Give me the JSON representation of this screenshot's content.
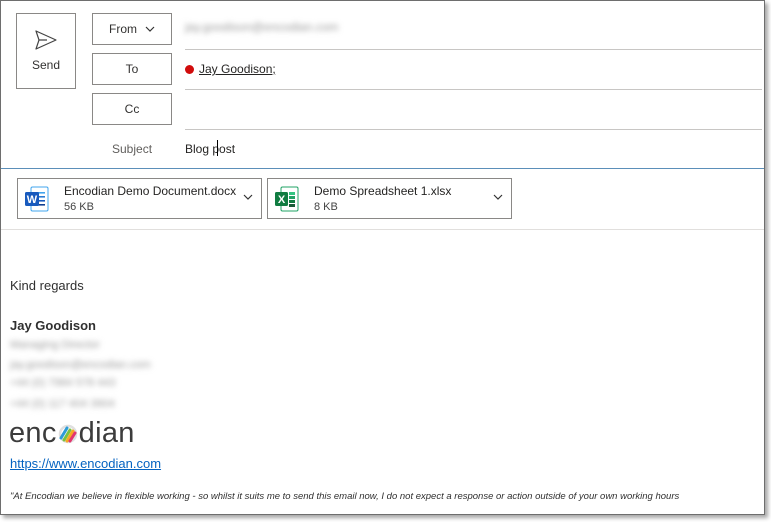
{
  "header": {
    "send_label": "Send",
    "from_label": "From",
    "from_address": "jay.goodison@encodian.com",
    "to_label": "To",
    "cc_label": "Cc",
    "subject_label": "Subject"
  },
  "recipients": [
    {
      "name": "Jay Goodison;",
      "status_color": "#d10c0c"
    }
  ],
  "subject": "Blog post",
  "attachments": [
    {
      "name": "Encodian Demo Document.docx",
      "size": "56 KB",
      "icon": "word-icon"
    },
    {
      "name": "Demo Spreadsheet 1.xlsx",
      "size": "8 KB",
      "icon": "excel-icon"
    }
  ],
  "body": {
    "greeting": "Kind regards",
    "signature": {
      "name": "Jay Goodison",
      "title_blurred": "Managing Director",
      "email_blurred": "jay.goodison@encodian.com",
      "phone1_blurred": "+44 (0) 7984 578 443",
      "phone2_blurred": "+44 (0) 117 404 3904",
      "logo_prefix": "enc",
      "logo_suffix": "dian",
      "website": "https://www.encodian.com",
      "disclaimer": "\"At Encodian we believe in flexible working - so whilst it suits me to send this email now, I do not expect a response or action outside of your own working hours"
    }
  },
  "colors": {
    "accent": "#5b8fb9",
    "link": "#0563c1",
    "word": "#185abd",
    "excel": "#107c41"
  }
}
